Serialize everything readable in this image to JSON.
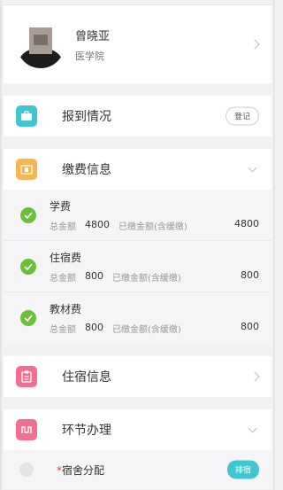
{
  "profile": {
    "name": "曾晓亚",
    "department": "医学院"
  },
  "checkin": {
    "title": "报到情况",
    "button": "登记"
  },
  "fees": {
    "title": "缴费信息",
    "total_label": "总金额",
    "paid_label": "已缴金额(含缓缴)",
    "items": [
      {
        "name": "学费",
        "total": "4800",
        "paid": "4800"
      },
      {
        "name": "住宿费",
        "total": "800",
        "paid": "800"
      },
      {
        "name": "教材费",
        "total": "800",
        "paid": "800"
      }
    ]
  },
  "accommodation": {
    "title": "住宿信息"
  },
  "process": {
    "title": "环节办理",
    "steps": [
      {
        "required_mark": "*",
        "label": "宿舍分配",
        "button": "排宿"
      }
    ]
  },
  "colors": {
    "teal": "#3ec6d1",
    "orange": "#f8b44e",
    "pink": "#f46e92",
    "success": "#67c23a"
  }
}
